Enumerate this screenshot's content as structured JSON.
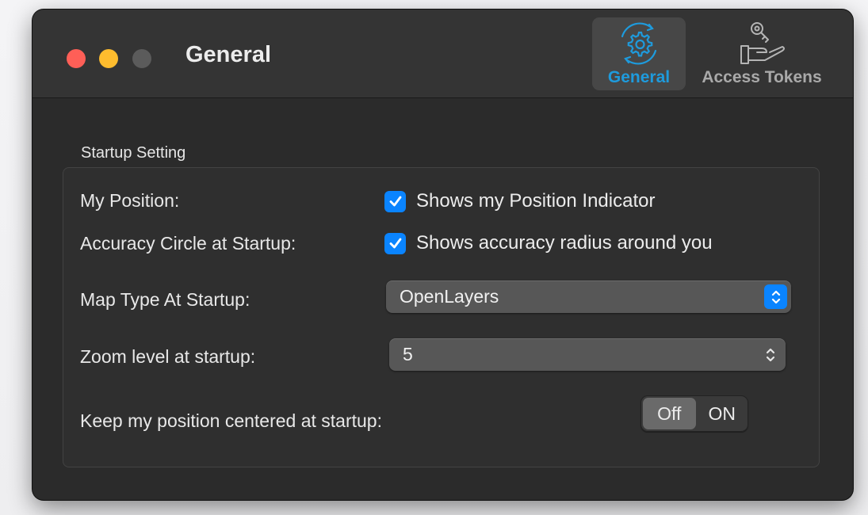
{
  "window": {
    "title": "General"
  },
  "toolbar": {
    "tabs": [
      {
        "label": "General",
        "icon": "gear-icon",
        "selected": true
      },
      {
        "label": "Access Tokens",
        "icon": "key-hand-icon",
        "selected": false
      }
    ]
  },
  "startup": {
    "group_title": "Startup Setting",
    "my_position": {
      "label": "My Position:",
      "checkbox_label": "Shows my Position Indicator",
      "checked": true
    },
    "accuracy_circle": {
      "label": "Accuracy Circle at Startup:",
      "checkbox_label": "Shows accuracy radius around you",
      "checked": true
    },
    "map_type": {
      "label": "Map Type At Startup:",
      "value": "OpenLayers"
    },
    "zoom_level": {
      "label": "Zoom level at startup:",
      "value": "5"
    },
    "keep_centered": {
      "label": "Keep my position centered at startup:",
      "off_label": "Off",
      "on_label": "ON",
      "selected": "Off"
    }
  },
  "colors": {
    "accent": "#0a84ff",
    "selected_tab_text": "#1e9bdd",
    "close": "#fe5f57",
    "minimize": "#febc2e"
  }
}
